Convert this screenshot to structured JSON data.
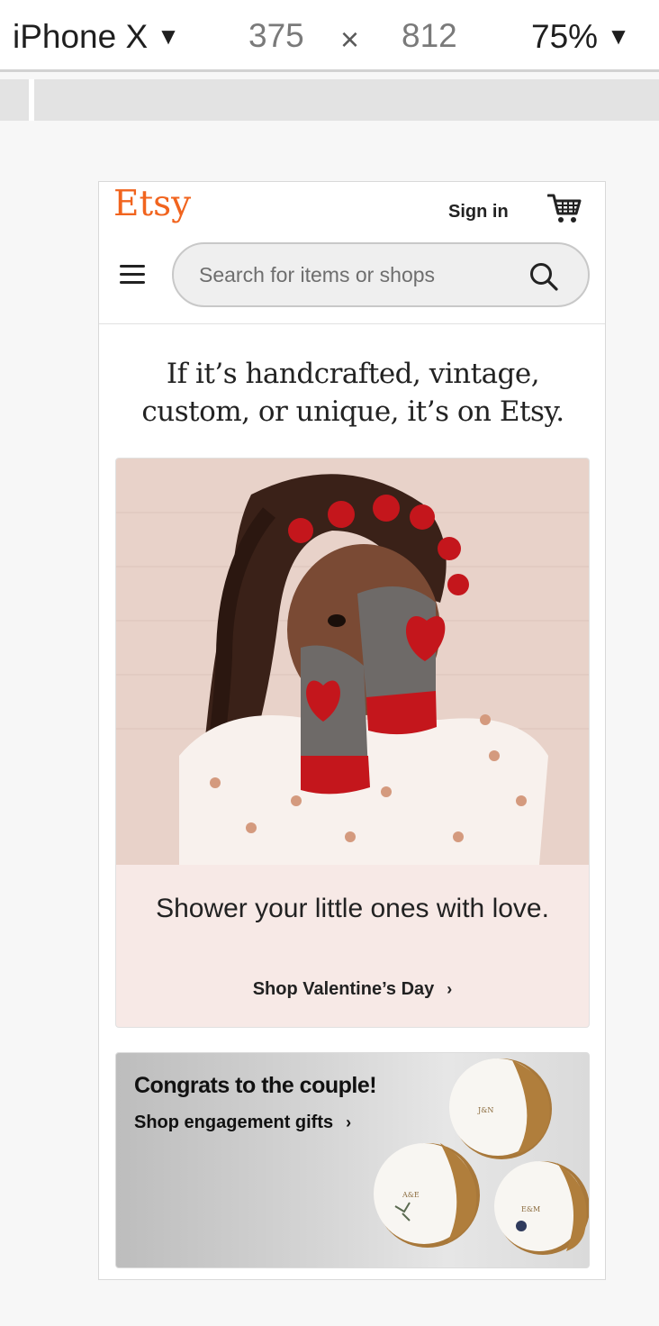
{
  "devtools": {
    "device": "iPhone X",
    "width": "375",
    "times": "×",
    "height": "812",
    "zoom": "75%",
    "caret": "▼"
  },
  "header": {
    "logo": "Etsy",
    "sign_in": "Sign in",
    "search_placeholder": "Search for items or shops"
  },
  "hero": {
    "tagline": "If it’s handcrafted, vintage, custom, or unique, it’s on Etsy."
  },
  "promo": {
    "text": "Shower your little ones with love.",
    "link": "Shop Valentine’s Day",
    "chevron": "›"
  },
  "promo2": {
    "title": "Congrats to the couple!",
    "link": "Shop engagement gifts",
    "chevron": "›",
    "dish_labels": [
      "J&N",
      "A&E",
      "E&M"
    ]
  },
  "colors": {
    "brand": "#f1641e",
    "promo_bg": "#f7e9e6",
    "heart_red": "#c4161c"
  }
}
